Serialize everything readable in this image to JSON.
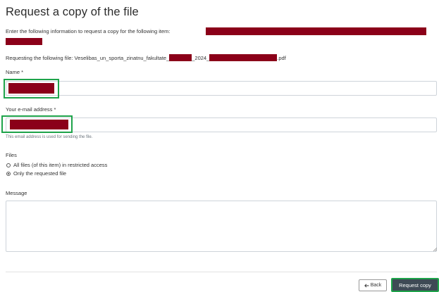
{
  "page": {
    "title": "Request a copy of the file"
  },
  "intro": {
    "text": "Enter the following information to request a copy for the following item:"
  },
  "file": {
    "prefix": "Requesting the following file: Veselibas_un_sporta_zinatnu_fakultate_",
    "middle": "_2024_",
    "suffix": ".pdf"
  },
  "form": {
    "name_label": "Name *",
    "email_label": "Your e-mail address *",
    "email_hint": "This email address is used for sending the file.",
    "files_label": "Files",
    "files_options": [
      "All files (of this item) in restricted access",
      "Only the requested file"
    ],
    "files_selected": "Only the requested file",
    "message_label": "Message"
  },
  "buttons": {
    "back": "Back",
    "back_icon": "arrow-left-icon",
    "request": "Request copy"
  },
  "colors": {
    "redaction": "#8b0019",
    "highlight": "#1ea34a",
    "primary_button": "#3e4a55"
  }
}
